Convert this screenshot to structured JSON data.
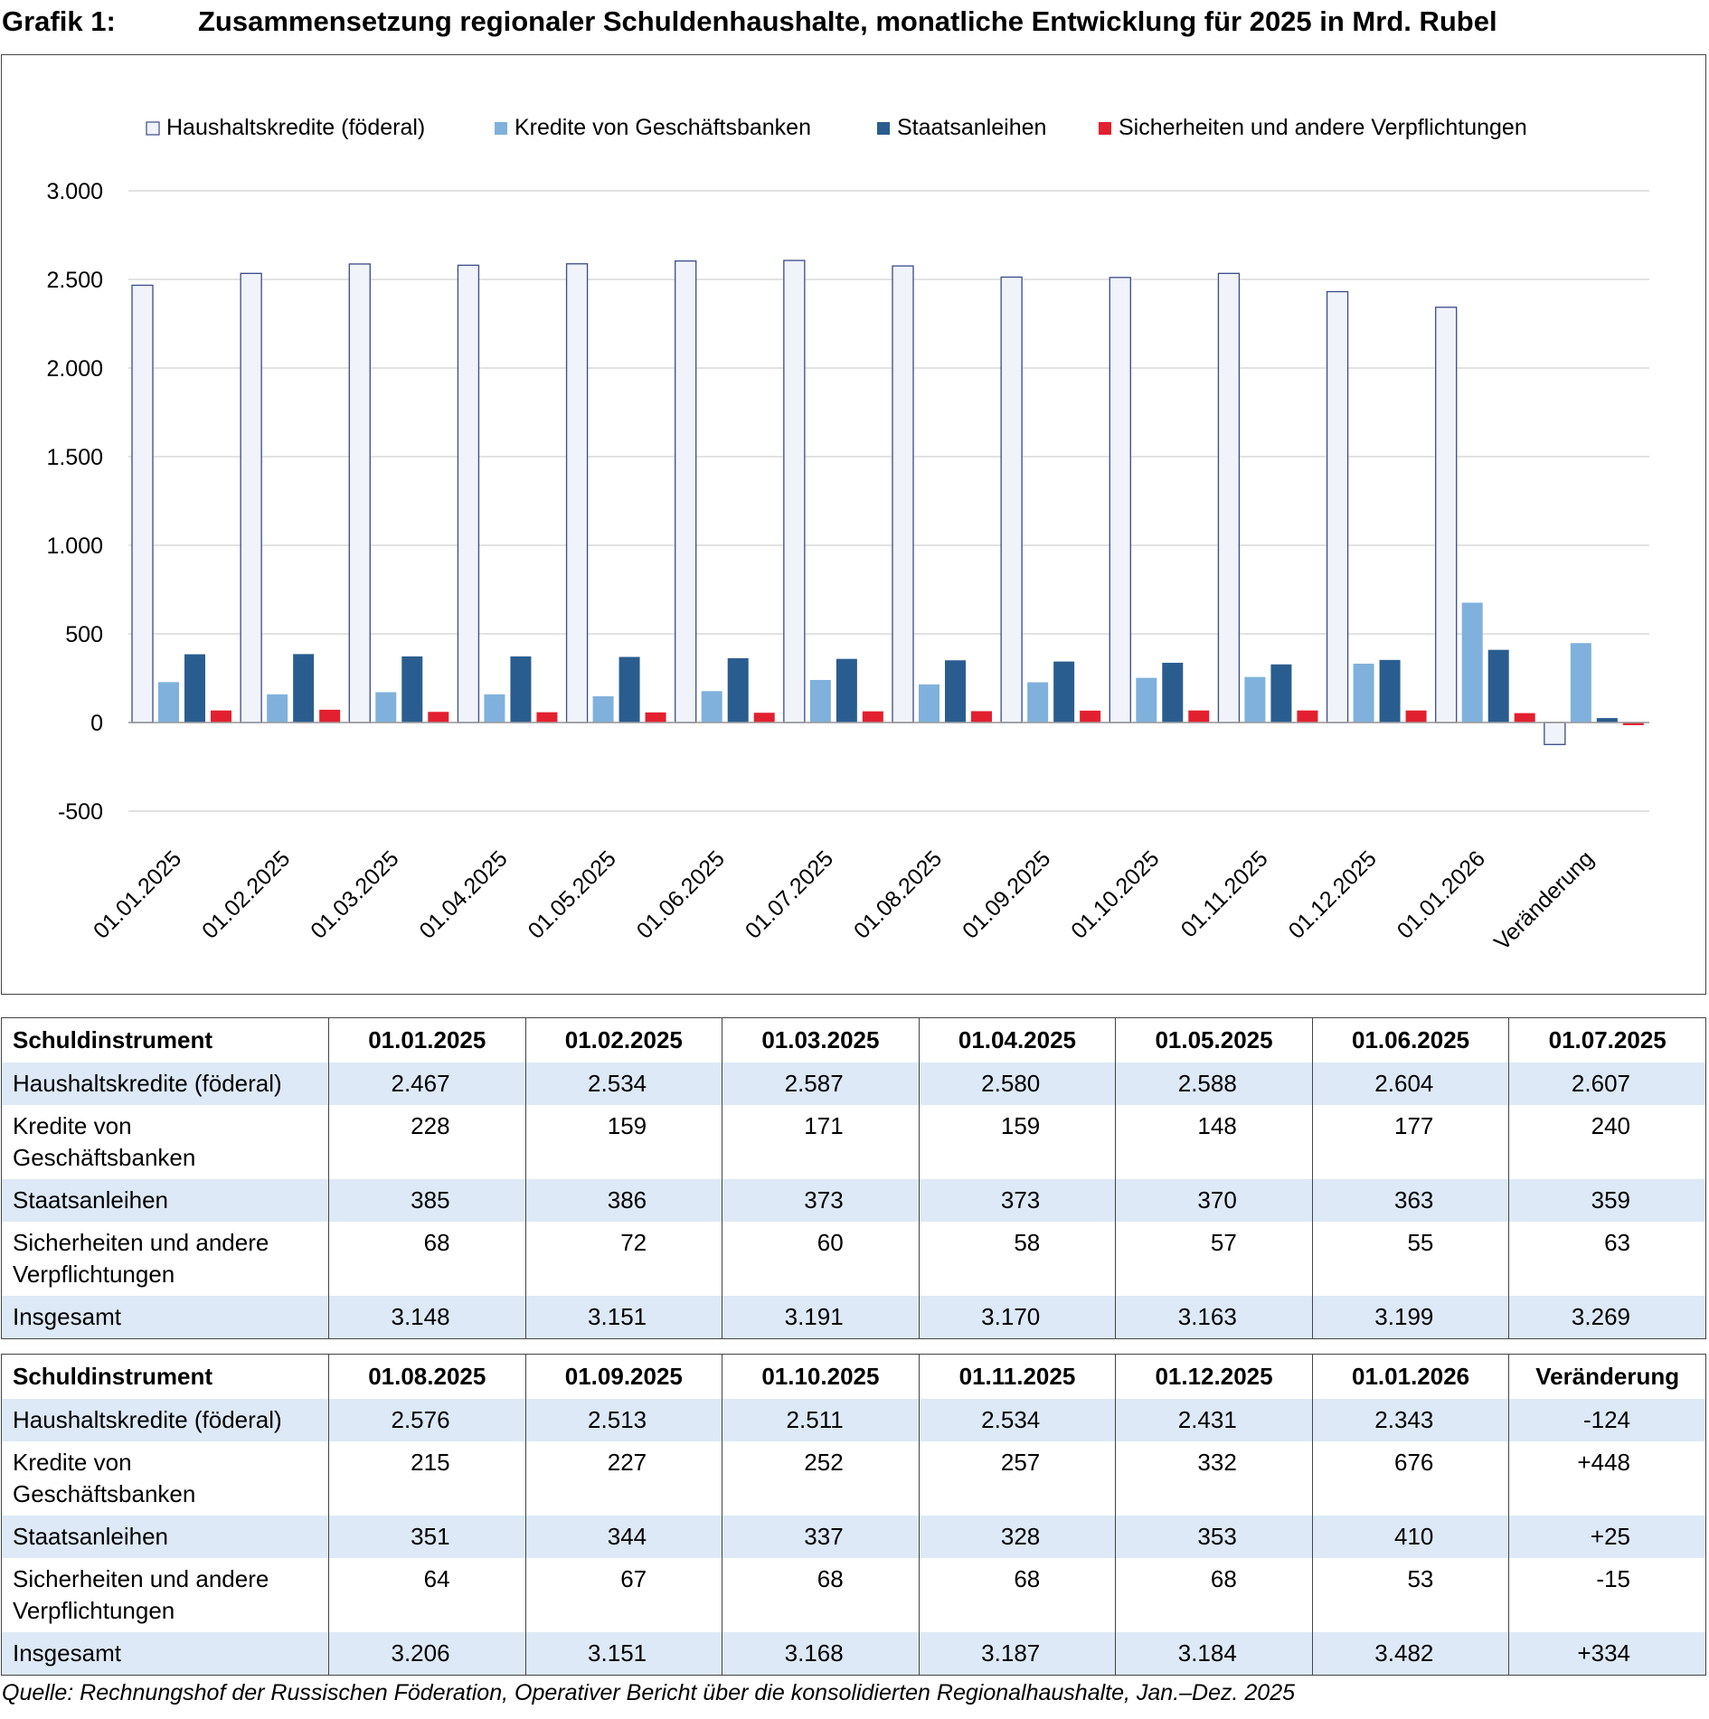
{
  "figure": {
    "label": "Grafik 1:",
    "title": "Zusammensetzung regionaler Schuldenhaushalte, monatliche Entwicklung für 2025 in Mrd. Rubel"
  },
  "chart_data": {
    "type": "bar",
    "title": "",
    "xlabel": "",
    "ylabel": "",
    "ylim": [
      -500,
      3000
    ],
    "yticks": [
      3000,
      2500,
      2000,
      1500,
      1000,
      500,
      0,
      -500
    ],
    "ytick_labels": [
      "3.000",
      "2.500",
      "2.000",
      "1.500",
      "1.000",
      "500",
      "0",
      "-500"
    ],
    "grid": true,
    "legend_position": "top",
    "categories": [
      "01.01.2025",
      "01.02.2025",
      "01.03.2025",
      "01.04.2025",
      "01.05.2025",
      "01.06.2025",
      "01.07.2025",
      "01.08.2025",
      "01.09.2025",
      "01.10.2025",
      "01.11.2025",
      "01.12.2025",
      "01.01.2026",
      "Veränderung"
    ],
    "series": [
      {
        "name": "Haushaltskredite (föderal)",
        "color": "#f0f3fa",
        "stroke": "#3a4a8a",
        "values": [
          2467,
          2534,
          2587,
          2580,
          2588,
          2604,
          2607,
          2576,
          2513,
          2511,
          2534,
          2431,
          2343,
          -124
        ]
      },
      {
        "name": "Kredite von Geschäftsbanken",
        "color": "#7fb1dc",
        "stroke": "none",
        "values": [
          228,
          159,
          171,
          159,
          148,
          177,
          240,
          215,
          227,
          252,
          257,
          332,
          676,
          448
        ]
      },
      {
        "name": "Staatsanleihen",
        "color": "#2a5d8f",
        "stroke": "none",
        "values": [
          385,
          386,
          373,
          373,
          370,
          363,
          359,
          351,
          344,
          337,
          328,
          353,
          410,
          25
        ]
      },
      {
        "name": "Sicherheiten und andere Verpflichtungen",
        "color": "#e3202f",
        "stroke": "none",
        "values": [
          68,
          72,
          60,
          58,
          57,
          55,
          63,
          64,
          67,
          68,
          68,
          68,
          53,
          -15
        ]
      }
    ]
  },
  "table1": {
    "header": [
      "Schuldinstrument",
      "01.01.2025",
      "01.02.2025",
      "01.03.2025",
      "01.04.2025",
      "01.05.2025",
      "01.06.2025",
      "01.07.2025"
    ],
    "rows": [
      [
        "Haushaltskredite (föderal)",
        "2.467",
        "2.534",
        "2.587",
        "2.580",
        "2.588",
        "2.604",
        "2.607"
      ],
      [
        "Kredite von Geschäftsbanken",
        "228",
        "159",
        "171",
        "159",
        "148",
        "177",
        "240"
      ],
      [
        "Staatsanleihen",
        "385",
        "386",
        "373",
        "373",
        "370",
        "363",
        "359"
      ],
      [
        "Sicherheiten und andere Verpflichtungen",
        "68",
        "72",
        "60",
        "58",
        "57",
        "55",
        "63"
      ],
      [
        "Insgesamt",
        "3.148",
        "3.151",
        "3.191",
        "3.170",
        "3.163",
        "3.199",
        "3.269"
      ]
    ]
  },
  "table2": {
    "header": [
      "Schuldinstrument",
      "01.08.2025",
      "01.09.2025",
      "01.10.2025",
      "01.11.2025",
      "01.12.2025",
      "01.01.2026",
      "Veränderung"
    ],
    "rows": [
      [
        "Haushaltskredite (föderal)",
        "2.576",
        "2.513",
        "2.511",
        "2.534",
        "2.431",
        "2.343",
        "-124"
      ],
      [
        "Kredite von Geschäftsbanken",
        "215",
        "227",
        "252",
        "257",
        "332",
        "676",
        "+448"
      ],
      [
        "Staatsanleihen",
        "351",
        "344",
        "337",
        "328",
        "353",
        "410",
        "+25"
      ],
      [
        "Sicherheiten und andere Verpflichtungen",
        "64",
        "67",
        "68",
        "68",
        "68",
        "53",
        "-15"
      ],
      [
        "Insgesamt",
        "3.206",
        "3.151",
        "3.168",
        "3.187",
        "3.184",
        "3.482",
        "+334"
      ]
    ]
  },
  "source": "Quelle: Rechnungshof der Russischen Föderation, Operativer Bericht über die konsolidierten Regionalhaushalte, Jan.–Dez. 2025"
}
